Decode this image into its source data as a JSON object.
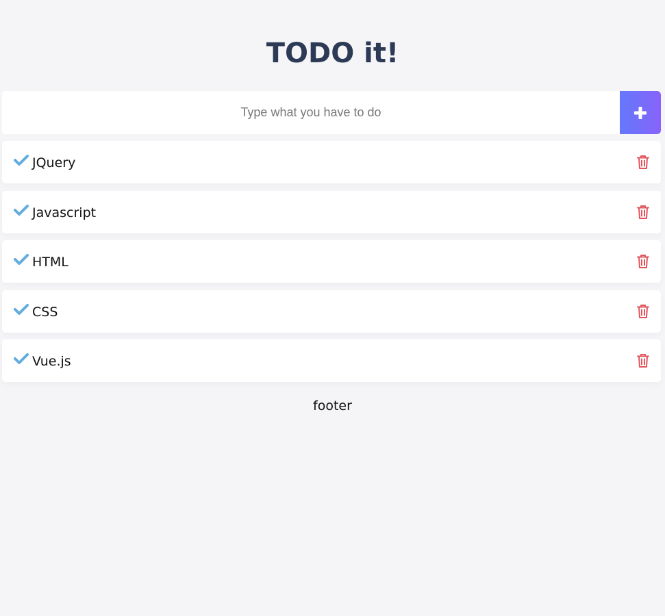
{
  "header": {
    "title": "TODO it!"
  },
  "input": {
    "placeholder": "Type what you have to do",
    "value": "",
    "add_icon": "plus-icon",
    "accent_start": "#6478fb",
    "accent_end": "#8763fb"
  },
  "todos": [
    {
      "text": "JQuery",
      "completed": true
    },
    {
      "text": "Javascript",
      "completed": true
    },
    {
      "text": "HTML",
      "completed": true
    },
    {
      "text": "CSS",
      "completed": true
    },
    {
      "text": "Vue.js",
      "completed": true
    }
  ],
  "icons": {
    "check": "check-icon",
    "delete": "trash-icon"
  },
  "colors": {
    "title": "#2d3a55",
    "check": "#62acde",
    "delete": "#e0545c",
    "background": "#f5f5f8"
  },
  "footer": {
    "text": "footer"
  }
}
